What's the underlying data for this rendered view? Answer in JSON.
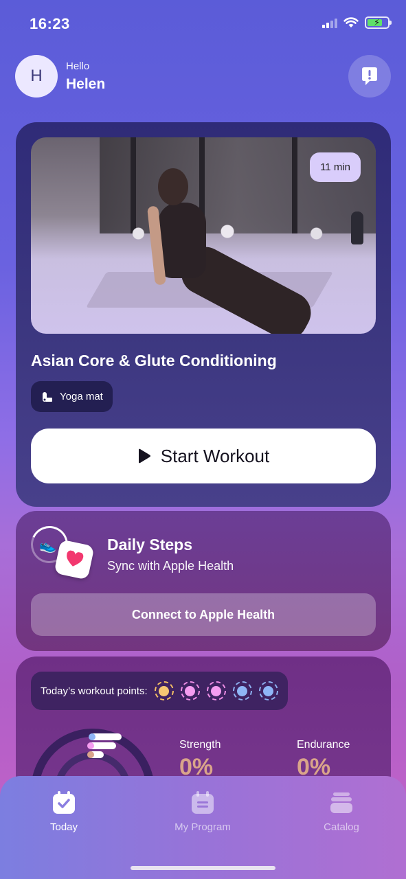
{
  "status_bar": {
    "time": "16:23",
    "icons": [
      "signal-icon",
      "wifi-icon",
      "battery-charging-icon"
    ]
  },
  "header": {
    "avatar_initial": "H",
    "greeting": "Hello",
    "user_name": "Helen",
    "feedback_icon": "feedback-icon"
  },
  "workout": {
    "duration": "11 min",
    "title": "Asian Core & Glute Conditioning",
    "equipment": "Yoga mat",
    "start_label": "Start Workout"
  },
  "steps": {
    "title": "Daily Steps",
    "subtitle": "Sync with Apple Health",
    "connect_label": "Connect to Apple Health"
  },
  "points": {
    "label": "Today’s workout points:",
    "dots": [
      {
        "color": "#f7c873",
        "ring": "#f5c064"
      },
      {
        "color": "#f59cf0",
        "ring": "#ef8ee6"
      },
      {
        "color": "#f59cf0",
        "ring": "#ef8ee6"
      },
      {
        "color": "#8fb6f7",
        "ring": "#8db0f0"
      },
      {
        "color": "#8fb6f7",
        "ring": "#8db0f0"
      }
    ],
    "stats": [
      {
        "label": "Strength",
        "value": "0%"
      },
      {
        "label": "Endurance",
        "value": "0%"
      }
    ]
  },
  "tabbar": {
    "tabs": [
      {
        "label": "Today",
        "icon": "calendar-check-icon",
        "active": true
      },
      {
        "label": "My Program",
        "icon": "program-list-icon",
        "active": false
      },
      {
        "label": "Catalog",
        "icon": "catalog-stack-icon",
        "active": false
      }
    ]
  },
  "colors": {
    "accent": "#5b5cd8",
    "workout_card": "#2f2b78",
    "start_button_bg": "#ffffff",
    "stat_value": "#d9a48a"
  }
}
